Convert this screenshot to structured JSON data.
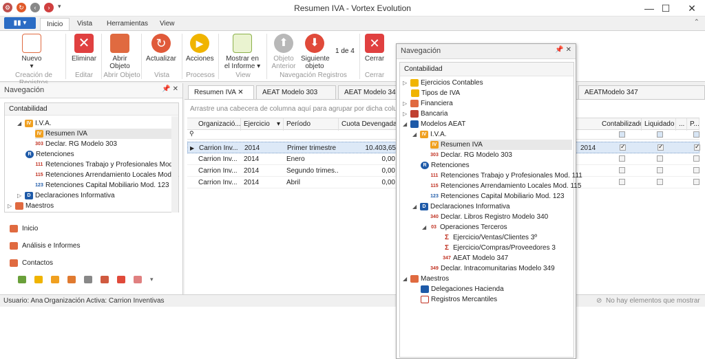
{
  "window": {
    "title": "Resumen IVA - Vortex Evolution"
  },
  "ribbon_tabs": [
    "Inicio",
    "Vista",
    "Herramientas",
    "View"
  ],
  "ribbon": {
    "nuevo": "Nuevo",
    "eliminar": "Eliminar",
    "abrir1": "Abrir",
    "abrir2": "Objeto",
    "actualizar": "Actualizar",
    "acciones": "Acciones",
    "mostrar1": "Mostrar en",
    "mostrar2": "el Informe",
    "objant1": "Objeto",
    "objant2": "Anterior",
    "sig1": "Siguiente",
    "sig2": "objeto",
    "page": "1 de 4",
    "cerrar": "Cerrar",
    "groups": [
      "Creación de Registros",
      "Editar",
      "Abrir Objeto",
      "Vista",
      "Procesos",
      "View",
      "Navegación Registros",
      "Cerrar"
    ]
  },
  "leftnav": {
    "header": "Navegación",
    "section": "Contabilidad",
    "items": [
      "I.V.A.",
      "Resumen IVA",
      "Declar. RG Modelo 303",
      "Retenciones",
      "Retenciones Trabajo y Profesionales Mod...",
      "Retenciones Arrendamiento Locales Mod....",
      "Retenciones Capital Mobiliario Mod. 123",
      "Declaraciones Informativa",
      "Maestros"
    ],
    "links": [
      "Inicio",
      "Análisis e Informes",
      "Contactos"
    ]
  },
  "doctabs": [
    "Resumen IVA",
    "AEAT Modelo 303",
    "AEAT Modelo 34",
    "AEATModelo 347"
  ],
  "grid": {
    "group_hint": "Arrastre una cabecera de columna aquí para agrupar por dicha columna",
    "columns": [
      "Organizació...",
      "Ejercicio",
      "Período",
      "Cuota Devengada"
    ],
    "rows": [
      [
        "Carrion Inv...",
        "2014",
        "Primer trimestre",
        "10.403,65"
      ],
      [
        "Carrion Inv...",
        "2014",
        "Enero",
        "0,00"
      ],
      [
        "Carrion Inv...",
        "2014",
        "Segundo trimes...",
        "0,00"
      ],
      [
        "Carrion Inv...",
        "2014",
        "Abril",
        "0,00"
      ]
    ],
    "right_columns": [
      "Contabilizado",
      "Liquidado",
      "...",
      "P..."
    ],
    "right_row1_partial": "2014",
    "checks": [
      [
        true,
        true,
        true
      ],
      [
        false,
        false,
        false
      ],
      [
        false,
        false,
        false
      ],
      [
        false,
        false,
        false
      ]
    ]
  },
  "floatnav": {
    "header": "Navegación",
    "section": "Contabilidad",
    "items": [
      "Ejercicios Contables",
      "Tipos de IVA",
      "Financiera",
      "Bancaria",
      "Modelos AEAT",
      "I.V.A.",
      "Resumen IVA",
      "Declar. RG Modelo 303",
      "Retenciones",
      "Retenciones Trabajo y Profesionales Mod. 111",
      "Retenciones Arrendamiento Locales Mod. 115",
      "Retenciones Capital Mobiliario Mod. 123",
      "Declaraciones Informativa",
      "Declar. Libros Registro Modelo 340",
      "Operaciones Terceros",
      "Ejercicio/Ventas/Clientes 3º",
      "Ejercicio/Compras/Proveedores 3",
      "AEAT Modelo 347",
      "Declar. Intracomunitarias Modelo 349",
      "Maestros",
      "Delegaciones Hacienda",
      "Registros Mercantiles"
    ]
  },
  "status": {
    "user": "Usuario: Ana",
    "org": "Organización Activa: Carrion Inventivas",
    "empty": "No hay elementos que mostrar"
  }
}
